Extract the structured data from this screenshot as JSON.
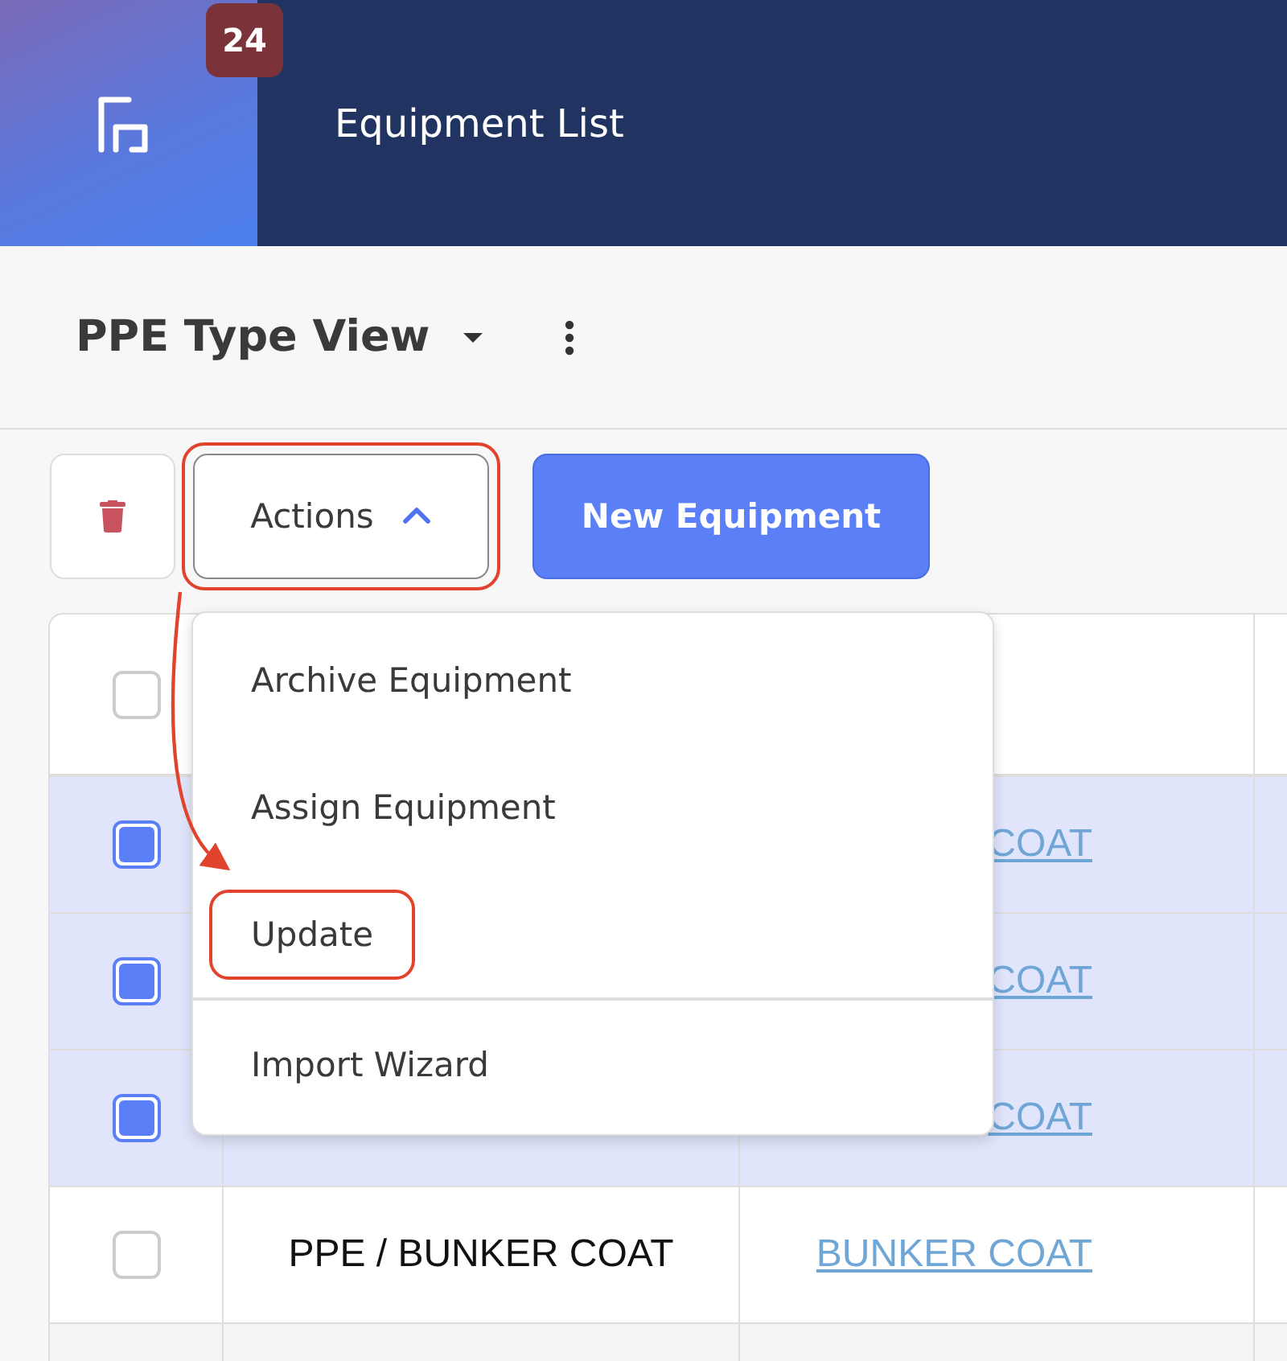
{
  "header": {
    "badge": "24",
    "title": "Equipment List"
  },
  "view": {
    "title": "PPE Type View"
  },
  "toolbar": {
    "actions_button": {
      "label": "Actions",
      "expanded": true,
      "annotated": true
    },
    "new_button": {
      "label": "New Equipment"
    }
  },
  "actions_menu": [
    {
      "label": "Archive Equipment",
      "annotated": false,
      "separated": false
    },
    {
      "label": "Assign Equipment",
      "annotated": false,
      "separated": false
    },
    {
      "label": "Update",
      "annotated": true,
      "separated": false
    },
    {
      "label": "Import Wizard",
      "annotated": false,
      "separated": true
    }
  ],
  "table": {
    "header": {
      "checked": false
    },
    "rows": [
      {
        "checked": true,
        "selected": true,
        "column_3": "COAT"
      },
      {
        "checked": true,
        "selected": true,
        "column_3": "COAT"
      },
      {
        "checked": true,
        "selected": true,
        "column_3": "COAT"
      },
      {
        "checked": false,
        "selected": false,
        "column_2": "PPE / BUNKER COAT",
        "column_3": "BUNKER COAT"
      }
    ]
  }
}
